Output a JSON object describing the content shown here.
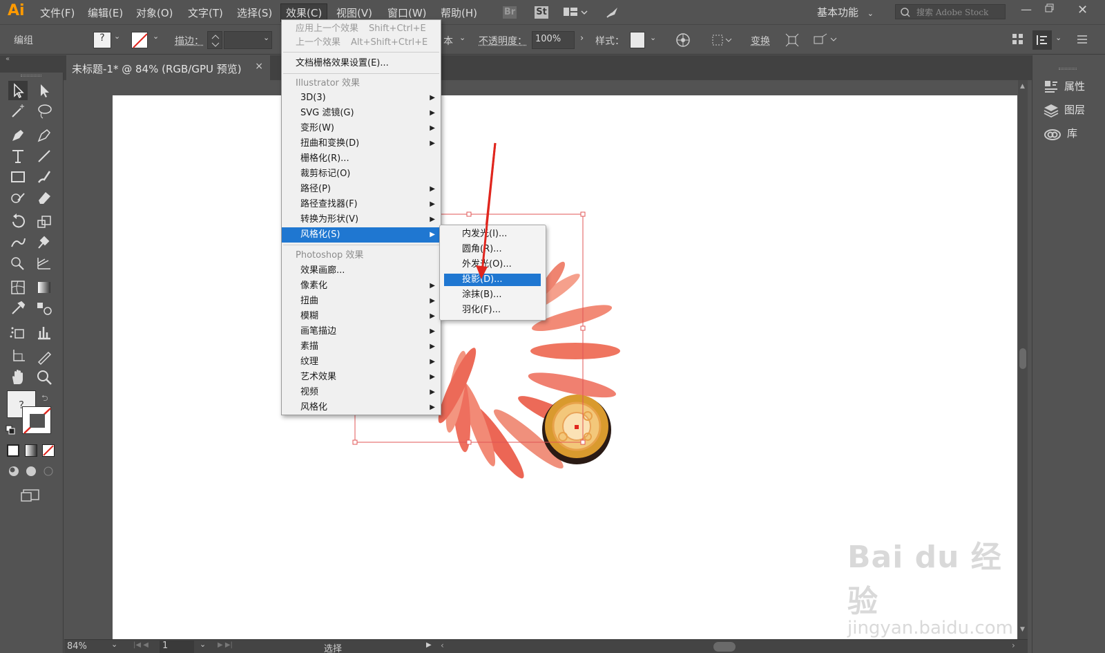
{
  "app": {
    "logo": "Ai"
  },
  "menubar": {
    "items": [
      "文件(F)",
      "编辑(E)",
      "对象(O)",
      "文字(T)",
      "选择(S)",
      "效果(C)",
      "视图(V)",
      "窗口(W)",
      "帮助(H)"
    ],
    "active": "效果(C)",
    "bridge_badge": "Br",
    "stock_badge": "St",
    "workspace": "基本功能",
    "search_placeholder": "搜索 Adobe Stock"
  },
  "controlbar": {
    "selection_label": "编组",
    "stroke_label": "描边：",
    "style_suffix": "本",
    "opacity_label": "不透明度：",
    "opacity_value": "100%",
    "style_label": "样式：",
    "transform_label": "变换"
  },
  "document_tab": {
    "title": "未标题-1* @ 84% (RGB/GPU 预览)",
    "close": "×"
  },
  "effect_menu": {
    "apply_last": "应用上一个效果",
    "apply_last_shortcut": "Shift+Ctrl+E",
    "last_effect": "上一个效果",
    "last_effect_shortcut": "Alt+Shift+Ctrl+E",
    "raster_settings": "文档栅格效果设置(E)...",
    "illustrator_header": "Illustrator 效果",
    "illustrator_items": [
      "3D(3)",
      "SVG 滤镜(G)",
      "变形(W)",
      "扭曲和变换(D)",
      "栅格化(R)...",
      "裁剪标记(O)",
      "路径(P)",
      "路径查找器(F)",
      "转换为形状(V)",
      "风格化(S)"
    ],
    "photoshop_header": "Photoshop 效果",
    "photoshop_items": [
      "效果画廊...",
      "像素化",
      "扭曲",
      "模糊",
      "画笔描边",
      "素描",
      "纹理",
      "艺术效果",
      "视频",
      "风格化"
    ]
  },
  "stylize_submenu": {
    "items": [
      "内发光(I)...",
      "圆角(R)...",
      "外发光(O)...",
      "投影(D)...",
      "涂抹(B)...",
      "羽化(F)..."
    ],
    "highlighted": "投影(D)..."
  },
  "right_panel": {
    "items": [
      "属性",
      "图层",
      "库"
    ]
  },
  "statusbar": {
    "zoom": "84%",
    "artboard": "1",
    "tool": "选择"
  },
  "watermark": {
    "brand": "Bai du 经验",
    "url": "jingyan.baidu.com"
  },
  "colors": {
    "ui_bg": "#535353",
    "menu_highlight": "#1f77d1",
    "ai_orange": "#ff9a00",
    "petal": "#ee6f5e",
    "arrow": "#e0261e"
  }
}
